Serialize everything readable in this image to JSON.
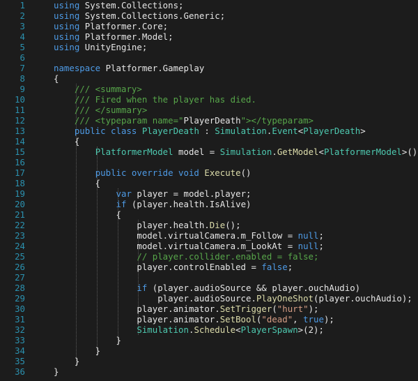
{
  "editor": {
    "language": "C#",
    "colors": {
      "background": "#1c1c1c",
      "line_number": "#2b91af",
      "kw": "#4e9be6",
      "type": "#4ec9b0",
      "fn": "#dcdcaa",
      "str": "#d69d85",
      "com": "#57a64a",
      "plain": "#e6e6e6"
    },
    "lines": [
      {
        "n": "1",
        "tokens": [
          [
            "kw",
            "using"
          ],
          [
            "plain",
            " System.Collections;"
          ]
        ]
      },
      {
        "n": "2",
        "tokens": [
          [
            "kw",
            "using"
          ],
          [
            "plain",
            " System.Collections.Generic;"
          ]
        ]
      },
      {
        "n": "3",
        "tokens": [
          [
            "kw",
            "using"
          ],
          [
            "plain",
            " Platformer.Core;"
          ]
        ]
      },
      {
        "n": "4",
        "tokens": [
          [
            "kw",
            "using"
          ],
          [
            "plain",
            " Platformer.Model;"
          ]
        ]
      },
      {
        "n": "5",
        "tokens": [
          [
            "kw",
            "using"
          ],
          [
            "plain",
            " UnityEngine;"
          ]
        ]
      },
      {
        "n": "6",
        "tokens": []
      },
      {
        "n": "7",
        "tokens": [
          [
            "kw",
            "namespace"
          ],
          [
            "plain",
            " Platformer.Gameplay"
          ]
        ]
      },
      {
        "n": "8",
        "tokens": [
          [
            "plain",
            "{"
          ]
        ]
      },
      {
        "n": "9",
        "tokens": [
          [
            "plain",
            "    "
          ],
          [
            "com",
            "/// <summary>"
          ]
        ]
      },
      {
        "n": "10",
        "tokens": [
          [
            "plain",
            "    "
          ],
          [
            "com",
            "/// Fired when the player has died."
          ]
        ]
      },
      {
        "n": "11",
        "tokens": [
          [
            "plain",
            "    "
          ],
          [
            "com",
            "/// </summary>"
          ]
        ]
      },
      {
        "n": "12",
        "tokens": [
          [
            "plain",
            "    "
          ],
          [
            "com",
            "/// <typeparam name=\""
          ],
          [
            "plain",
            "PlayerDeath"
          ],
          [
            "com",
            "\"></typeparam>"
          ]
        ]
      },
      {
        "n": "13",
        "tokens": [
          [
            "plain",
            "    "
          ],
          [
            "kw",
            "public class"
          ],
          [
            "plain",
            " "
          ],
          [
            "type",
            "PlayerDeath"
          ],
          [
            "plain",
            " : "
          ],
          [
            "type",
            "Simulation"
          ],
          [
            "plain",
            "."
          ],
          [
            "type",
            "Event"
          ],
          [
            "plain",
            "<"
          ],
          [
            "type",
            "PlayerDeath"
          ],
          [
            "plain",
            ">"
          ]
        ]
      },
      {
        "n": "14",
        "tokens": [
          [
            "plain",
            "    {"
          ]
        ]
      },
      {
        "n": "15",
        "tokens": [
          [
            "plain",
            "        "
          ],
          [
            "type",
            "PlatformerModel"
          ],
          [
            "plain",
            " model = "
          ],
          [
            "type",
            "Simulation"
          ],
          [
            "plain",
            "."
          ],
          [
            "fn",
            "GetModel"
          ],
          [
            "plain",
            "<"
          ],
          [
            "type",
            "PlatformerModel"
          ],
          [
            "plain",
            ">();"
          ]
        ]
      },
      {
        "n": "16",
        "tokens": []
      },
      {
        "n": "17",
        "tokens": [
          [
            "plain",
            "        "
          ],
          [
            "kw",
            "public override void"
          ],
          [
            "plain",
            " "
          ],
          [
            "fn",
            "Execute"
          ],
          [
            "plain",
            "()"
          ]
        ]
      },
      {
        "n": "18",
        "tokens": [
          [
            "plain",
            "        {"
          ]
        ]
      },
      {
        "n": "19",
        "tokens": [
          [
            "plain",
            "            "
          ],
          [
            "kw",
            "var"
          ],
          [
            "plain",
            " player = model.player;"
          ]
        ]
      },
      {
        "n": "20",
        "tokens": [
          [
            "plain",
            "            "
          ],
          [
            "kw",
            "if"
          ],
          [
            "plain",
            " (player.health.IsAlive)"
          ]
        ]
      },
      {
        "n": "21",
        "tokens": [
          [
            "plain",
            "            {"
          ]
        ]
      },
      {
        "n": "22",
        "tokens": [
          [
            "plain",
            "                player.health."
          ],
          [
            "fn",
            "Die"
          ],
          [
            "plain",
            "();"
          ]
        ]
      },
      {
        "n": "23",
        "tokens": [
          [
            "plain",
            "                model.virtualCamera.m_Follow = "
          ],
          [
            "kw",
            "null"
          ],
          [
            "plain",
            ";"
          ]
        ]
      },
      {
        "n": "24",
        "tokens": [
          [
            "plain",
            "                model.virtualCamera.m_LookAt = "
          ],
          [
            "kw",
            "null"
          ],
          [
            "plain",
            ";"
          ]
        ]
      },
      {
        "n": "25",
        "tokens": [
          [
            "plain",
            "                "
          ],
          [
            "com",
            "// player.collider.enabled = false;"
          ]
        ]
      },
      {
        "n": "26",
        "tokens": [
          [
            "plain",
            "                player.controlEnabled = "
          ],
          [
            "kw",
            "false"
          ],
          [
            "plain",
            ";"
          ]
        ]
      },
      {
        "n": "27",
        "tokens": []
      },
      {
        "n": "28",
        "tokens": [
          [
            "plain",
            "                "
          ],
          [
            "kw",
            "if"
          ],
          [
            "plain",
            " (player.audioSource && player.ouchAudio)"
          ]
        ]
      },
      {
        "n": "29",
        "tokens": [
          [
            "plain",
            "                    player.audioSource."
          ],
          [
            "fn",
            "PlayOneShot"
          ],
          [
            "plain",
            "(player.ouchAudio);"
          ]
        ]
      },
      {
        "n": "30",
        "tokens": [
          [
            "plain",
            "                player.animator."
          ],
          [
            "fn",
            "SetTrigger"
          ],
          [
            "plain",
            "("
          ],
          [
            "str",
            "\"hurt\""
          ],
          [
            "plain",
            ");"
          ]
        ]
      },
      {
        "n": "31",
        "tokens": [
          [
            "plain",
            "                player.animator."
          ],
          [
            "fn",
            "SetBool"
          ],
          [
            "plain",
            "("
          ],
          [
            "str",
            "\"dead\""
          ],
          [
            "plain",
            ", "
          ],
          [
            "kw",
            "true"
          ],
          [
            "plain",
            ");"
          ]
        ]
      },
      {
        "n": "32",
        "tokens": [
          [
            "plain",
            "                "
          ],
          [
            "type",
            "Simulation"
          ],
          [
            "plain",
            "."
          ],
          [
            "fn",
            "Schedule"
          ],
          [
            "plain",
            "<"
          ],
          [
            "type",
            "PlayerSpawn"
          ],
          [
            "plain",
            ">(2);"
          ]
        ]
      },
      {
        "n": "33",
        "tokens": [
          [
            "plain",
            "            }"
          ]
        ]
      },
      {
        "n": "34",
        "tokens": [
          [
            "plain",
            "        }"
          ]
        ]
      },
      {
        "n": "35",
        "tokens": [
          [
            "plain",
            "    }"
          ]
        ]
      },
      {
        "n": "36",
        "tokens": [
          [
            "plain",
            "}"
          ]
        ]
      }
    ]
  }
}
